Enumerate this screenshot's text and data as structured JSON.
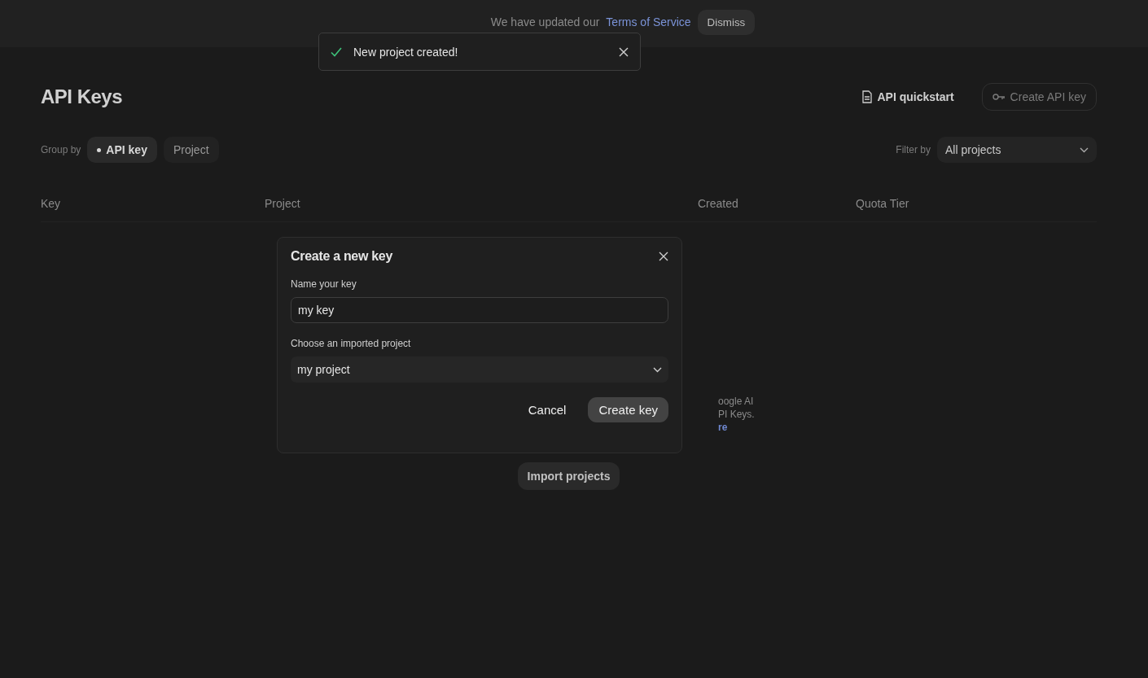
{
  "banner": {
    "text": "We have updated our",
    "link": "Terms of Service",
    "button": "Dismiss"
  },
  "toast": {
    "kind": "success",
    "message": "New project created!"
  },
  "page": {
    "title": "API Keys",
    "quickstart": "API quickstart",
    "create_button": {
      "label": "Create API key",
      "disabled": true
    }
  },
  "group_by": {
    "label": "Group by",
    "options": [
      {
        "label": "API key",
        "selected": true
      },
      {
        "label": "Project",
        "selected": false
      }
    ]
  },
  "filter": {
    "label": "Filter by",
    "value": "All projects"
  },
  "table": {
    "columns": [
      "Key",
      "Project",
      "Created",
      "Quota Tier"
    ]
  },
  "empty_state": {
    "lines": [
      "oogle AI",
      "PI Keys."
    ],
    "link": "re"
  },
  "import_button": "Import projects",
  "dialog": {
    "title": "Create a new key",
    "fields": [
      {
        "kind": "text",
        "label": "Name your key",
        "value": "my key"
      },
      {
        "kind": "select",
        "label": "Choose an imported project",
        "value": "my project"
      }
    ],
    "buttons": [
      {
        "kind": "secondary",
        "label": "Cancel"
      },
      {
        "kind": "primary",
        "label": "Create key"
      }
    ]
  }
}
